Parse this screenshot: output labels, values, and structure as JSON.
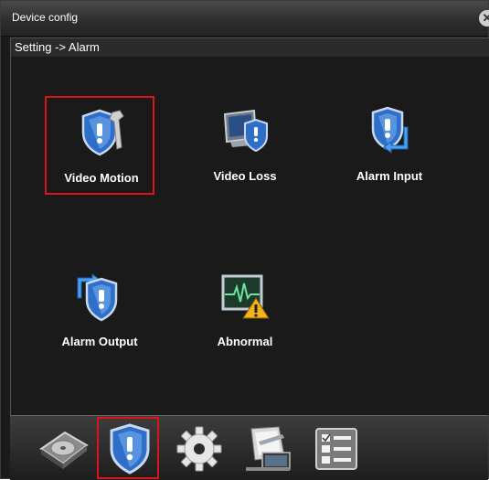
{
  "window": {
    "title": "Device config",
    "close_icon": "close-icon"
  },
  "breadcrumb": "Setting -> Alarm",
  "tiles": [
    {
      "label": "Video Motion",
      "icon": "shield-wrench-icon",
      "selected": true
    },
    {
      "label": "Video Loss",
      "icon": "monitor-shield-icon",
      "selected": false
    },
    {
      "label": "Alarm Input",
      "icon": "shield-arrow-in-icon",
      "selected": false
    },
    {
      "label": "Alarm Output",
      "icon": "shield-arrow-out-icon",
      "selected": false
    },
    {
      "label": "Abnormal",
      "icon": "heartbeat-warning-icon",
      "selected": false
    }
  ],
  "dock": [
    {
      "icon": "hard-disk-icon",
      "selected": false
    },
    {
      "icon": "alarm-shield-icon",
      "selected": true
    },
    {
      "icon": "gear-icon",
      "selected": false
    },
    {
      "icon": "network-tools-icon",
      "selected": false
    },
    {
      "icon": "checklist-icon",
      "selected": false
    }
  ],
  "colors": {
    "selection": "#d9141b",
    "shield": "#2f6fc9",
    "background": "#1a1a1a"
  }
}
